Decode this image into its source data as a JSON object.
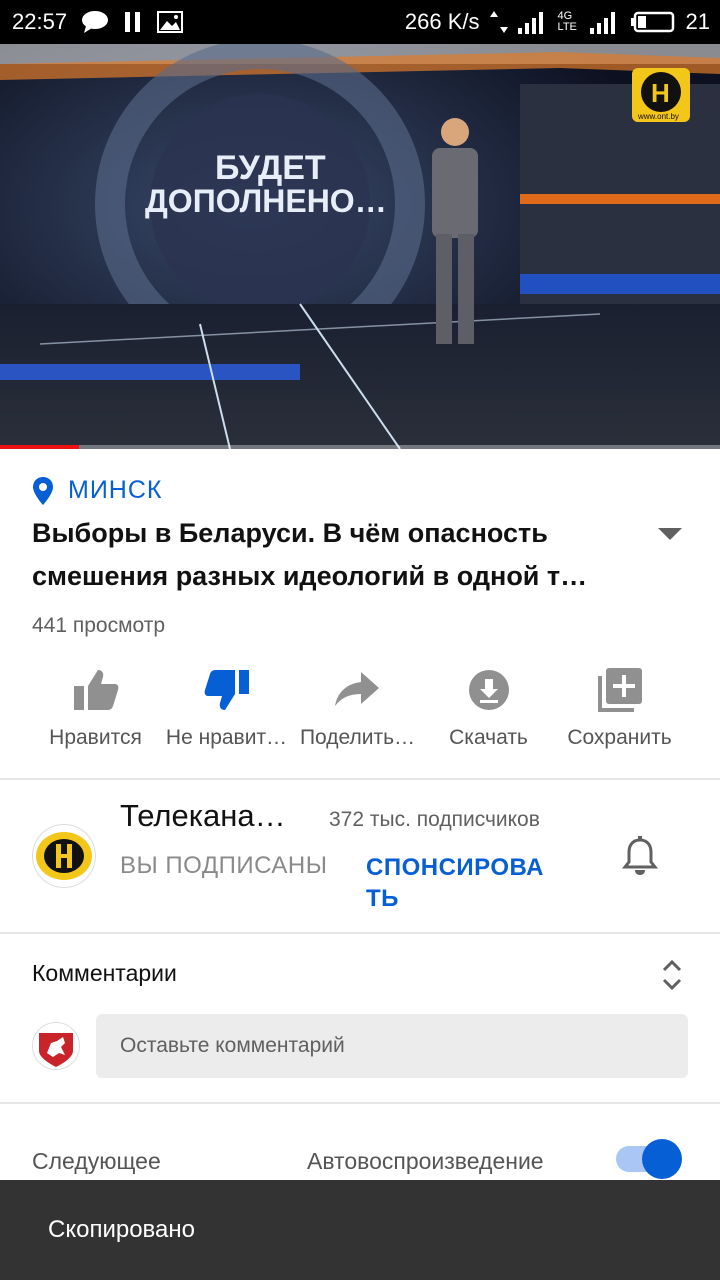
{
  "status_bar": {
    "time": "22:57",
    "speed": "266 K/s",
    "network": "4G LTE",
    "battery": "21",
    "icons": [
      "message-icon",
      "pause-icon",
      "image-icon",
      "data-arrows-icon",
      "signal-icon",
      "signal-icon",
      "battery-icon"
    ]
  },
  "video": {
    "overlay_text_line1": "БУДЕТ",
    "overlay_text_line2": "ДОПОЛНЕНО…",
    "watermark": "H",
    "watermark_small": "www.ont.by",
    "progress": 0.11
  },
  "meta": {
    "location": "МИНСК",
    "title": "Выборы в Беларуси. В чём опасность смешения разных идеологий в одной т…",
    "views": "441 просмотр"
  },
  "actions": [
    {
      "label": "Нравится",
      "icon": "thumbs-up-icon"
    },
    {
      "label": "Не нравит…",
      "icon": "thumbs-down-icon"
    },
    {
      "label": "Поделить…",
      "icon": "share-icon"
    },
    {
      "label": "Скачать",
      "icon": "download-icon"
    },
    {
      "label": "Сохранить",
      "icon": "playlist-add-icon"
    }
  ],
  "channel": {
    "name": "Телекана…",
    "subscribers": "372 тыс. подписчиков",
    "subscribed_label": "ВЫ ПОДПИСАНЫ",
    "sponsor_label": "СПОНСИРОВАТЬ"
  },
  "comments": {
    "title": "Комментарии",
    "placeholder": "Оставьте комментарий"
  },
  "up_next": {
    "label": "Следующее",
    "autoplay_label": "Автовоспроизведение",
    "autoplay_on": true
  },
  "toast": {
    "text": "Скопировано"
  },
  "colors": {
    "accent_blue": "#065fd4",
    "progress_red": "#ee1111",
    "toast_bg": "#333333"
  }
}
